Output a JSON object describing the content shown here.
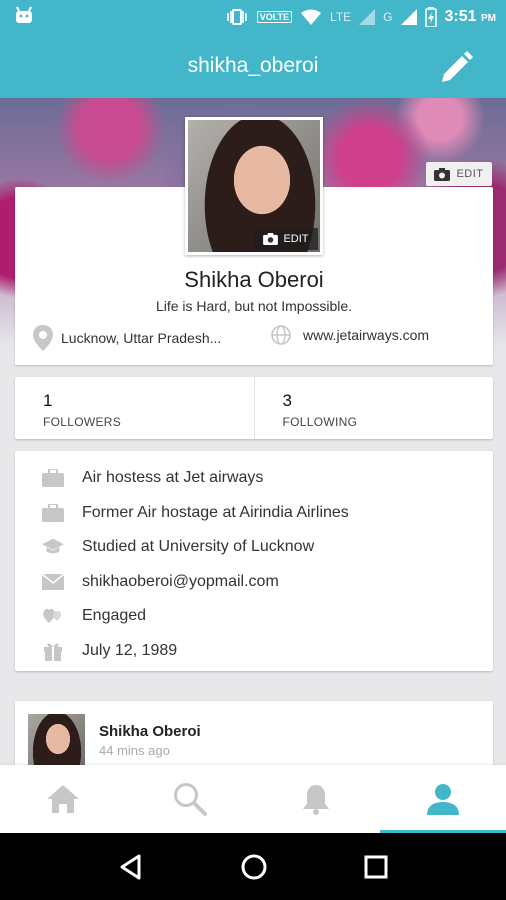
{
  "status_bar": {
    "volte": "VOLTE",
    "network_1": "LTE",
    "network_2": "G",
    "time": "3:51",
    "ampm": "PM"
  },
  "app_bar": {
    "title": "shikha_oberoi"
  },
  "cover": {
    "edit_label": "EDIT"
  },
  "profile": {
    "avatar_edit_label": "EDIT",
    "name": "Shikha Oberoi",
    "bio": "Life is Hard, but not Impossible.",
    "location": "Lucknow, Uttar Pradesh...",
    "website": "www.jetairways.com"
  },
  "follow": {
    "followers_count": "1",
    "followers_label": "FOLLOWERS",
    "following_count": "3",
    "following_label": "FOLLOWING"
  },
  "info": {
    "items": [
      {
        "icon": "briefcase-icon",
        "text": "Air hostess at Jet airways"
      },
      {
        "icon": "briefcase-icon",
        "text": "Former Air hostage at Airindia Airlines"
      },
      {
        "icon": "graduation-cap-icon",
        "text": "Studied at University of Lucknow"
      },
      {
        "icon": "envelope-icon",
        "text": "shikhaoberoi@yopmail.com"
      },
      {
        "icon": "hearts-icon",
        "text": "Engaged"
      },
      {
        "icon": "gift-icon",
        "text": "July 12, 1989"
      }
    ]
  },
  "post": {
    "author": "Shikha Oberoi",
    "time": "44 mins ago"
  },
  "bottom_nav": {
    "items": [
      "home-icon",
      "search-icon",
      "bell-icon",
      "profile-icon"
    ],
    "active": "profile-icon"
  },
  "colors": {
    "primary": "#43b7c9",
    "icon_grey": "#c7c7c7"
  }
}
